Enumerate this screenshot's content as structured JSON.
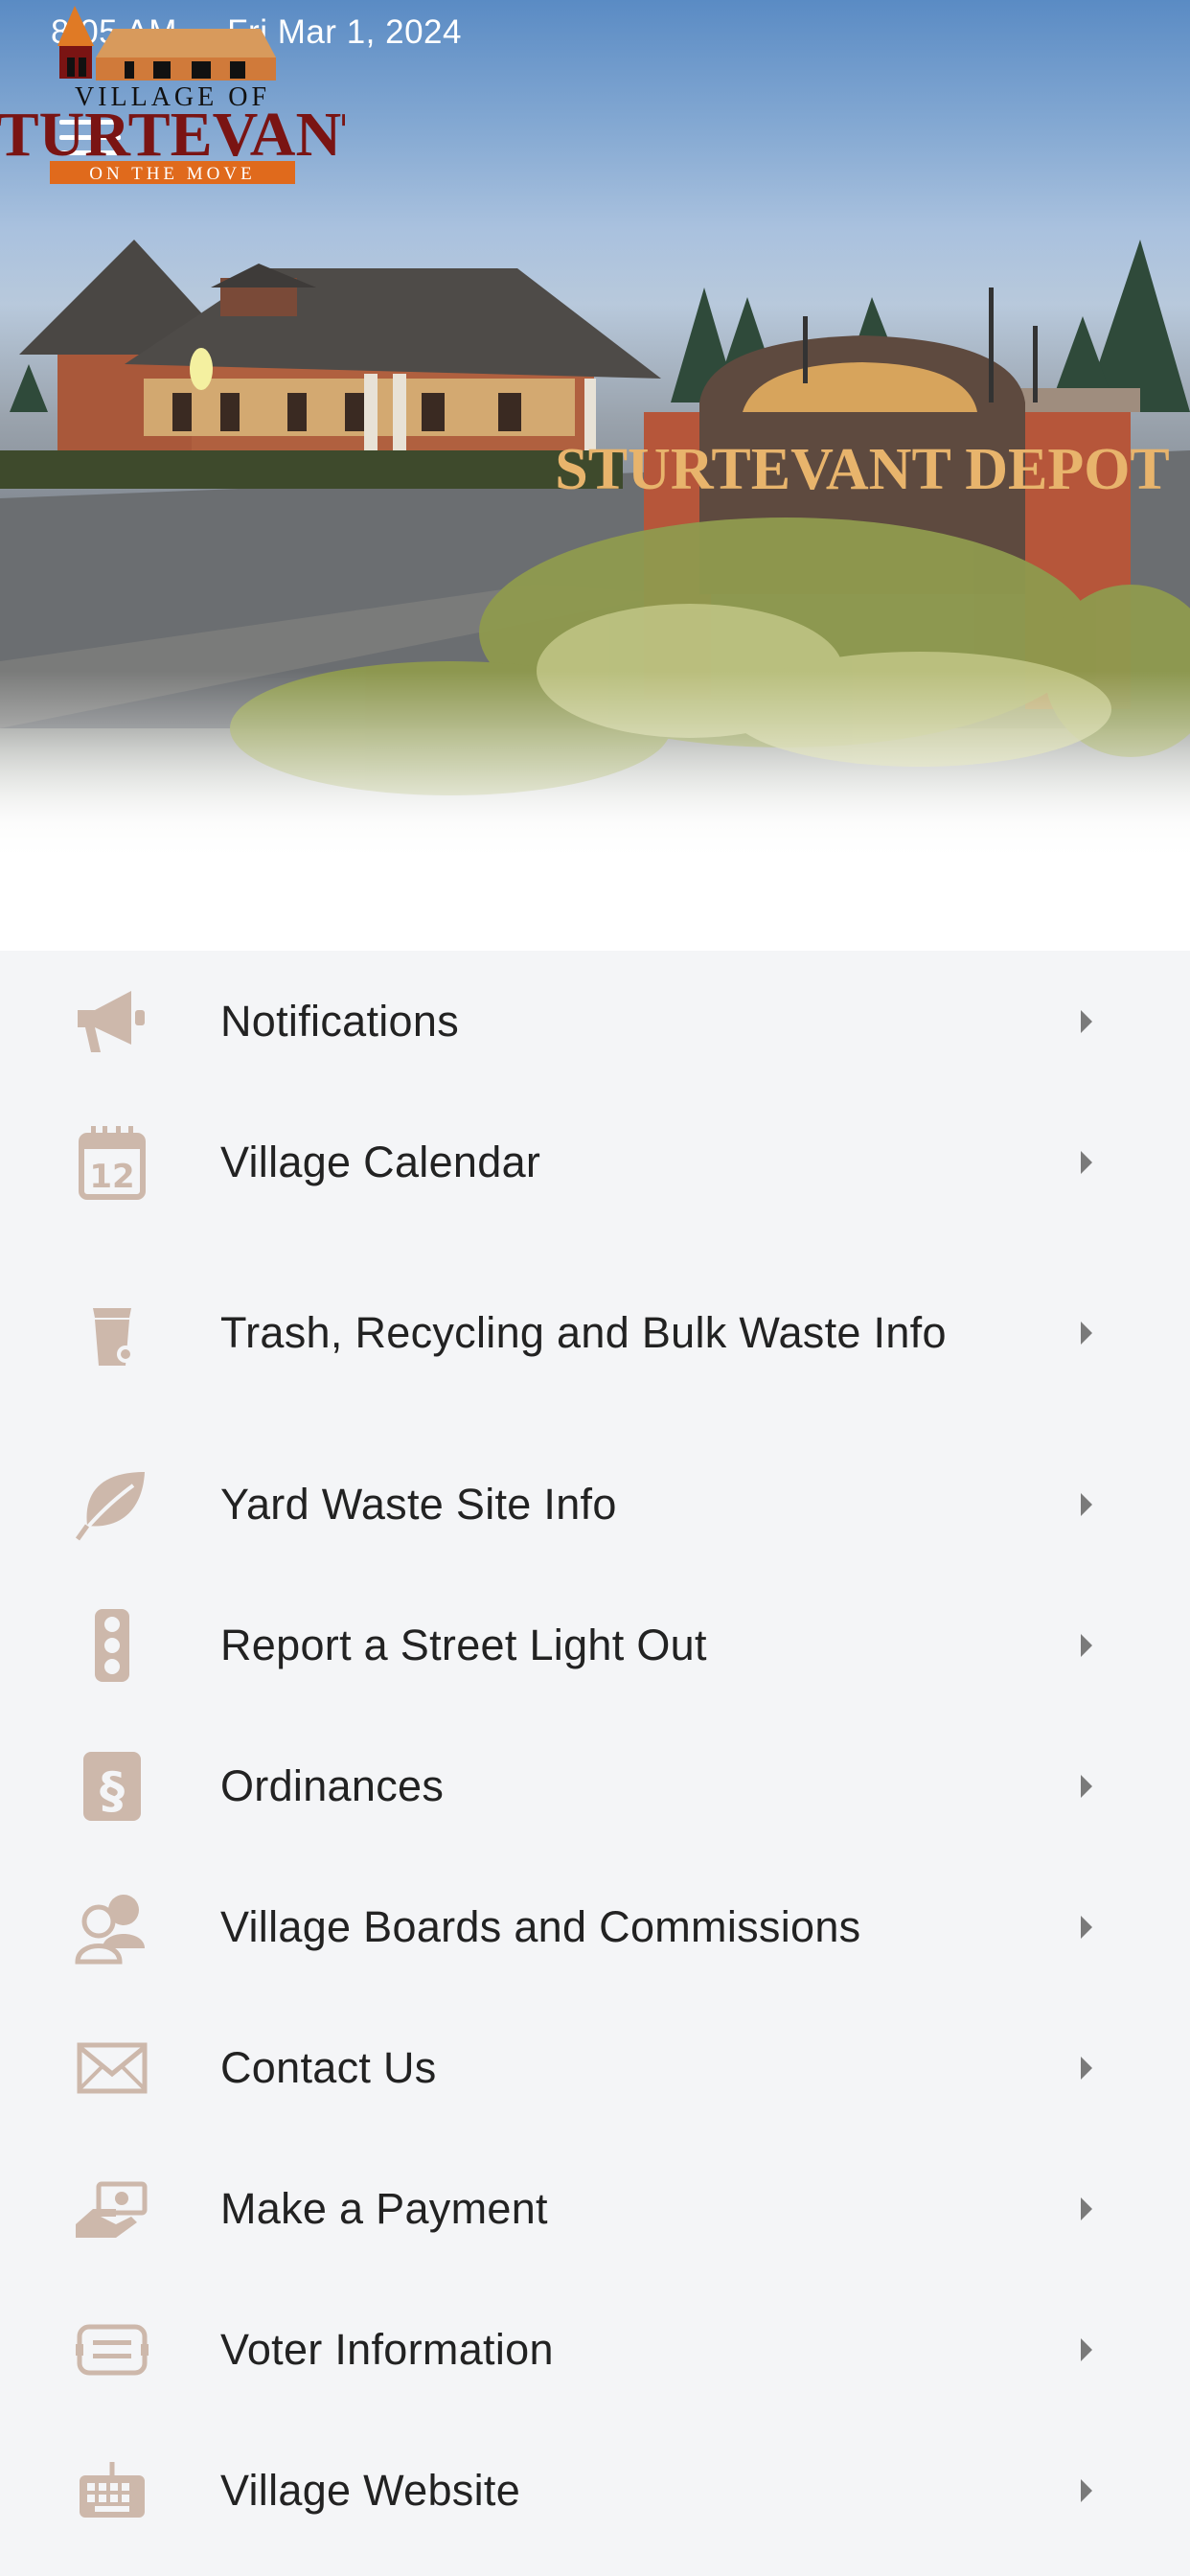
{
  "status_bar": {
    "time": "8:05 AM",
    "date": "Fri Mar 1, 2024"
  },
  "header": {
    "photo_sign_text": "STURTEVANT DEPOT",
    "logo": {
      "line1": "VILLAGE OF",
      "line2": "STURTEVANT",
      "line3": "ON THE MOVE"
    }
  },
  "colors": {
    "icon": "#cdb8ab",
    "text": "#222222",
    "chevron": "#7a7a7a",
    "list_bg": "#f4f5f7",
    "logo_red": "#7a1413",
    "logo_orange": "#e06a1c"
  },
  "menu": [
    {
      "label": "Notifications",
      "icon": "megaphone-icon"
    },
    {
      "label": "Village Calendar",
      "icon": "calendar-icon"
    },
    {
      "label": "Trash, Recycling and Bulk Waste Info",
      "icon": "trash-bin-icon"
    },
    {
      "label": "Yard Waste Site Info",
      "icon": "leaf-icon"
    },
    {
      "label": "Report a Street Light Out",
      "icon": "traffic-light-icon"
    },
    {
      "label": "Ordinances",
      "icon": "section-sign-icon"
    },
    {
      "label": "Village Boards and Commissions",
      "icon": "users-icon"
    },
    {
      "label": "Contact Us",
      "icon": "envelope-icon"
    },
    {
      "label": "Make a Payment",
      "icon": "hand-money-icon"
    },
    {
      "label": "Voter Information",
      "icon": "ballot-icon"
    },
    {
      "label": "Village Website",
      "icon": "keyboard-icon"
    }
  ]
}
